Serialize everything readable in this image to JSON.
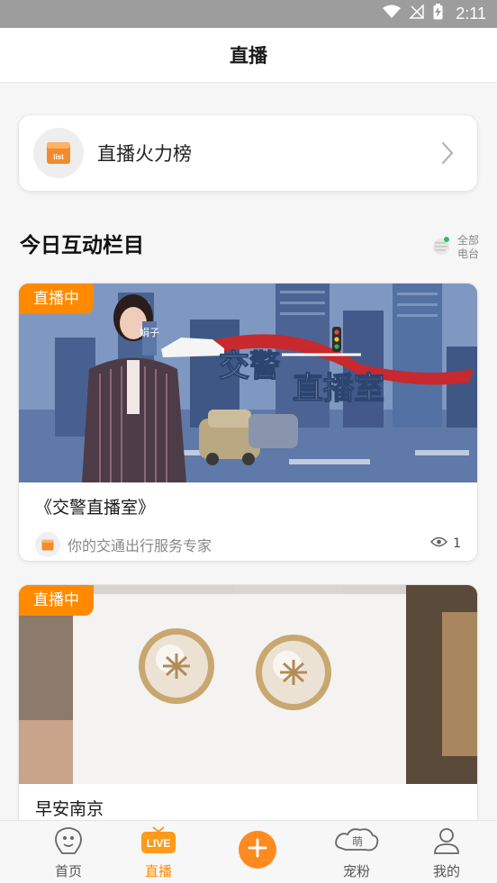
{
  "status_bar": {
    "time": "2:11"
  },
  "header": {
    "title": "直播"
  },
  "rank_card": {
    "label": "直播火力榜",
    "icon_text": "list"
  },
  "section": {
    "title": "今日互动栏目",
    "all_line1": "全部",
    "all_line2": "电台"
  },
  "programs": [
    {
      "badge": "直播中",
      "title": "《交警直播室》",
      "desc": "你的交通出行服务专家",
      "views": "1",
      "cover_text_1": "交警",
      "cover_text_2": "直播室",
      "cover_tag": "娟子"
    },
    {
      "badge": "直播中",
      "title": "早安南京"
    }
  ],
  "nav": {
    "home": "首页",
    "live": "直播",
    "live_badge": "LIVE",
    "pets": "宠粉",
    "pets_badge": "萌",
    "me": "我的"
  },
  "colors": {
    "accent": "#ff8a00",
    "background": "#f6f6f6"
  }
}
